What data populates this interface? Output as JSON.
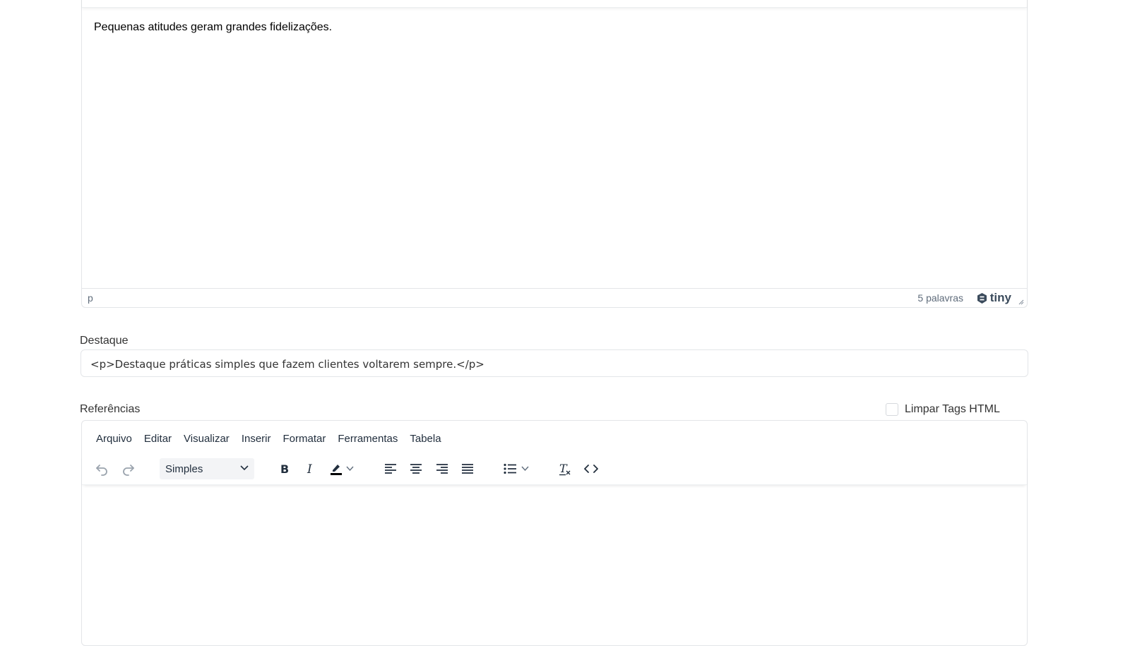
{
  "editor_top": {
    "content_text": "Pequenas atitudes geram grandes fidelizações.",
    "status_path": "p",
    "word_count": "5 palavras",
    "brand": "tiny"
  },
  "destaque": {
    "label": "Destaque",
    "value": "<p>Destaque práticas simples que fazem clientes voltarem sempre.</p>"
  },
  "referencias": {
    "label": "Referências",
    "clear_tags_label": "Limpar Tags HTML",
    "clear_tags_checked": false,
    "menu": [
      "Arquivo",
      "Editar",
      "Visualizar",
      "Inserir",
      "Formatar",
      "Ferramentas",
      "Tabela"
    ],
    "block_format": "Simples",
    "toolbar_icons": [
      "undo-icon",
      "redo-icon",
      "bold-icon",
      "italic-icon",
      "highlight-icon",
      "align-left-icon",
      "align-center-icon",
      "align-right-icon",
      "align-justify-icon",
      "bullet-list-icon",
      "clear-formatting-icon",
      "source-code-icon"
    ]
  }
}
